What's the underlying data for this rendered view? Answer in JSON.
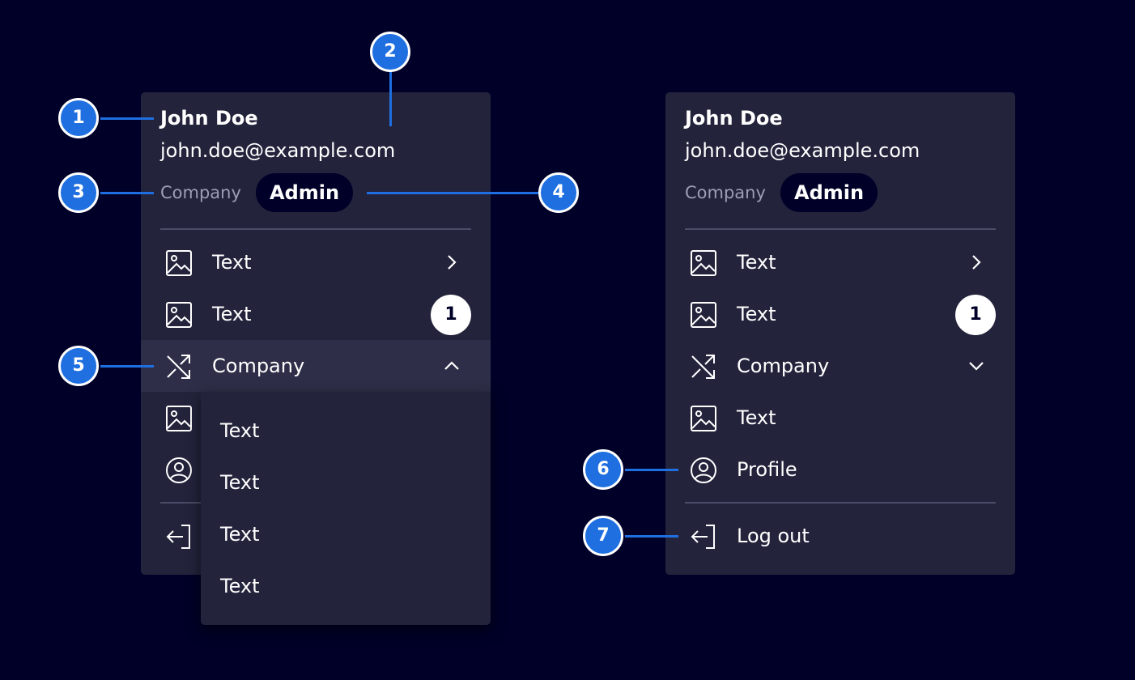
{
  "user": {
    "name": "John Doe",
    "email": "john.doe@example.com",
    "company": "Company",
    "role": "Admin"
  },
  "left_menu": {
    "items": [
      {
        "label": "Text",
        "icon": "image-icon",
        "trailing": "chevron-right-icon"
      },
      {
        "label": "Text",
        "icon": "image-icon",
        "badge": "1"
      },
      {
        "label": "Company",
        "icon": "shuffle-icon",
        "trailing": "chevron-up-icon",
        "state": "expanded"
      }
    ],
    "submenu": [
      "Text",
      "Text",
      "Text",
      "Text"
    ]
  },
  "right_menu": {
    "items": [
      {
        "label": "Text",
        "icon": "image-icon",
        "trailing": "chevron-right-icon"
      },
      {
        "label": "Text",
        "icon": "image-icon",
        "badge": "1"
      },
      {
        "label": "Company",
        "icon": "shuffle-icon",
        "trailing": "chevron-down-icon",
        "state": "collapsed"
      },
      {
        "label": "Text",
        "icon": "image-icon"
      },
      {
        "label": "Profile",
        "icon": "user-circle-icon"
      }
    ],
    "logout": {
      "label": "Log out",
      "icon": "logout-icon"
    }
  },
  "annotations": [
    "1",
    "2",
    "3",
    "4",
    "5",
    "6",
    "7"
  ],
  "colors": {
    "background": "#000028",
    "panel": "#23233c",
    "annotation": "#1f6fe0",
    "badge": "#ffffff"
  }
}
